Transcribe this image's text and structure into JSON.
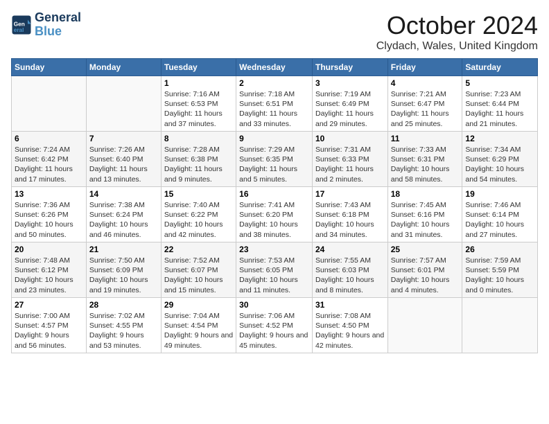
{
  "header": {
    "logo_line1": "General",
    "logo_line2": "Blue",
    "month": "October 2024",
    "location": "Clydach, Wales, United Kingdom"
  },
  "days_of_week": [
    "Sunday",
    "Monday",
    "Tuesday",
    "Wednesday",
    "Thursday",
    "Friday",
    "Saturday"
  ],
  "weeks": [
    [
      {
        "day": "",
        "info": ""
      },
      {
        "day": "",
        "info": ""
      },
      {
        "day": "1",
        "info": "Sunrise: 7:16 AM\nSunset: 6:53 PM\nDaylight: 11 hours and 37 minutes."
      },
      {
        "day": "2",
        "info": "Sunrise: 7:18 AM\nSunset: 6:51 PM\nDaylight: 11 hours and 33 minutes."
      },
      {
        "day": "3",
        "info": "Sunrise: 7:19 AM\nSunset: 6:49 PM\nDaylight: 11 hours and 29 minutes."
      },
      {
        "day": "4",
        "info": "Sunrise: 7:21 AM\nSunset: 6:47 PM\nDaylight: 11 hours and 25 minutes."
      },
      {
        "day": "5",
        "info": "Sunrise: 7:23 AM\nSunset: 6:44 PM\nDaylight: 11 hours and 21 minutes."
      }
    ],
    [
      {
        "day": "6",
        "info": "Sunrise: 7:24 AM\nSunset: 6:42 PM\nDaylight: 11 hours and 17 minutes."
      },
      {
        "day": "7",
        "info": "Sunrise: 7:26 AM\nSunset: 6:40 PM\nDaylight: 11 hours and 13 minutes."
      },
      {
        "day": "8",
        "info": "Sunrise: 7:28 AM\nSunset: 6:38 PM\nDaylight: 11 hours and 9 minutes."
      },
      {
        "day": "9",
        "info": "Sunrise: 7:29 AM\nSunset: 6:35 PM\nDaylight: 11 hours and 5 minutes."
      },
      {
        "day": "10",
        "info": "Sunrise: 7:31 AM\nSunset: 6:33 PM\nDaylight: 11 hours and 2 minutes."
      },
      {
        "day": "11",
        "info": "Sunrise: 7:33 AM\nSunset: 6:31 PM\nDaylight: 10 hours and 58 minutes."
      },
      {
        "day": "12",
        "info": "Sunrise: 7:34 AM\nSunset: 6:29 PM\nDaylight: 10 hours and 54 minutes."
      }
    ],
    [
      {
        "day": "13",
        "info": "Sunrise: 7:36 AM\nSunset: 6:26 PM\nDaylight: 10 hours and 50 minutes."
      },
      {
        "day": "14",
        "info": "Sunrise: 7:38 AM\nSunset: 6:24 PM\nDaylight: 10 hours and 46 minutes."
      },
      {
        "day": "15",
        "info": "Sunrise: 7:40 AM\nSunset: 6:22 PM\nDaylight: 10 hours and 42 minutes."
      },
      {
        "day": "16",
        "info": "Sunrise: 7:41 AM\nSunset: 6:20 PM\nDaylight: 10 hours and 38 minutes."
      },
      {
        "day": "17",
        "info": "Sunrise: 7:43 AM\nSunset: 6:18 PM\nDaylight: 10 hours and 34 minutes."
      },
      {
        "day": "18",
        "info": "Sunrise: 7:45 AM\nSunset: 6:16 PM\nDaylight: 10 hours and 31 minutes."
      },
      {
        "day": "19",
        "info": "Sunrise: 7:46 AM\nSunset: 6:14 PM\nDaylight: 10 hours and 27 minutes."
      }
    ],
    [
      {
        "day": "20",
        "info": "Sunrise: 7:48 AM\nSunset: 6:12 PM\nDaylight: 10 hours and 23 minutes."
      },
      {
        "day": "21",
        "info": "Sunrise: 7:50 AM\nSunset: 6:09 PM\nDaylight: 10 hours and 19 minutes."
      },
      {
        "day": "22",
        "info": "Sunrise: 7:52 AM\nSunset: 6:07 PM\nDaylight: 10 hours and 15 minutes."
      },
      {
        "day": "23",
        "info": "Sunrise: 7:53 AM\nSunset: 6:05 PM\nDaylight: 10 hours and 11 minutes."
      },
      {
        "day": "24",
        "info": "Sunrise: 7:55 AM\nSunset: 6:03 PM\nDaylight: 10 hours and 8 minutes."
      },
      {
        "day": "25",
        "info": "Sunrise: 7:57 AM\nSunset: 6:01 PM\nDaylight: 10 hours and 4 minutes."
      },
      {
        "day": "26",
        "info": "Sunrise: 7:59 AM\nSunset: 5:59 PM\nDaylight: 10 hours and 0 minutes."
      }
    ],
    [
      {
        "day": "27",
        "info": "Sunrise: 7:00 AM\nSunset: 4:57 PM\nDaylight: 9 hours and 56 minutes."
      },
      {
        "day": "28",
        "info": "Sunrise: 7:02 AM\nSunset: 4:55 PM\nDaylight: 9 hours and 53 minutes."
      },
      {
        "day": "29",
        "info": "Sunrise: 7:04 AM\nSunset: 4:54 PM\nDaylight: 9 hours and 49 minutes."
      },
      {
        "day": "30",
        "info": "Sunrise: 7:06 AM\nSunset: 4:52 PM\nDaylight: 9 hours and 45 minutes."
      },
      {
        "day": "31",
        "info": "Sunrise: 7:08 AM\nSunset: 4:50 PM\nDaylight: 9 hours and 42 minutes."
      },
      {
        "day": "",
        "info": ""
      },
      {
        "day": "",
        "info": ""
      }
    ]
  ]
}
